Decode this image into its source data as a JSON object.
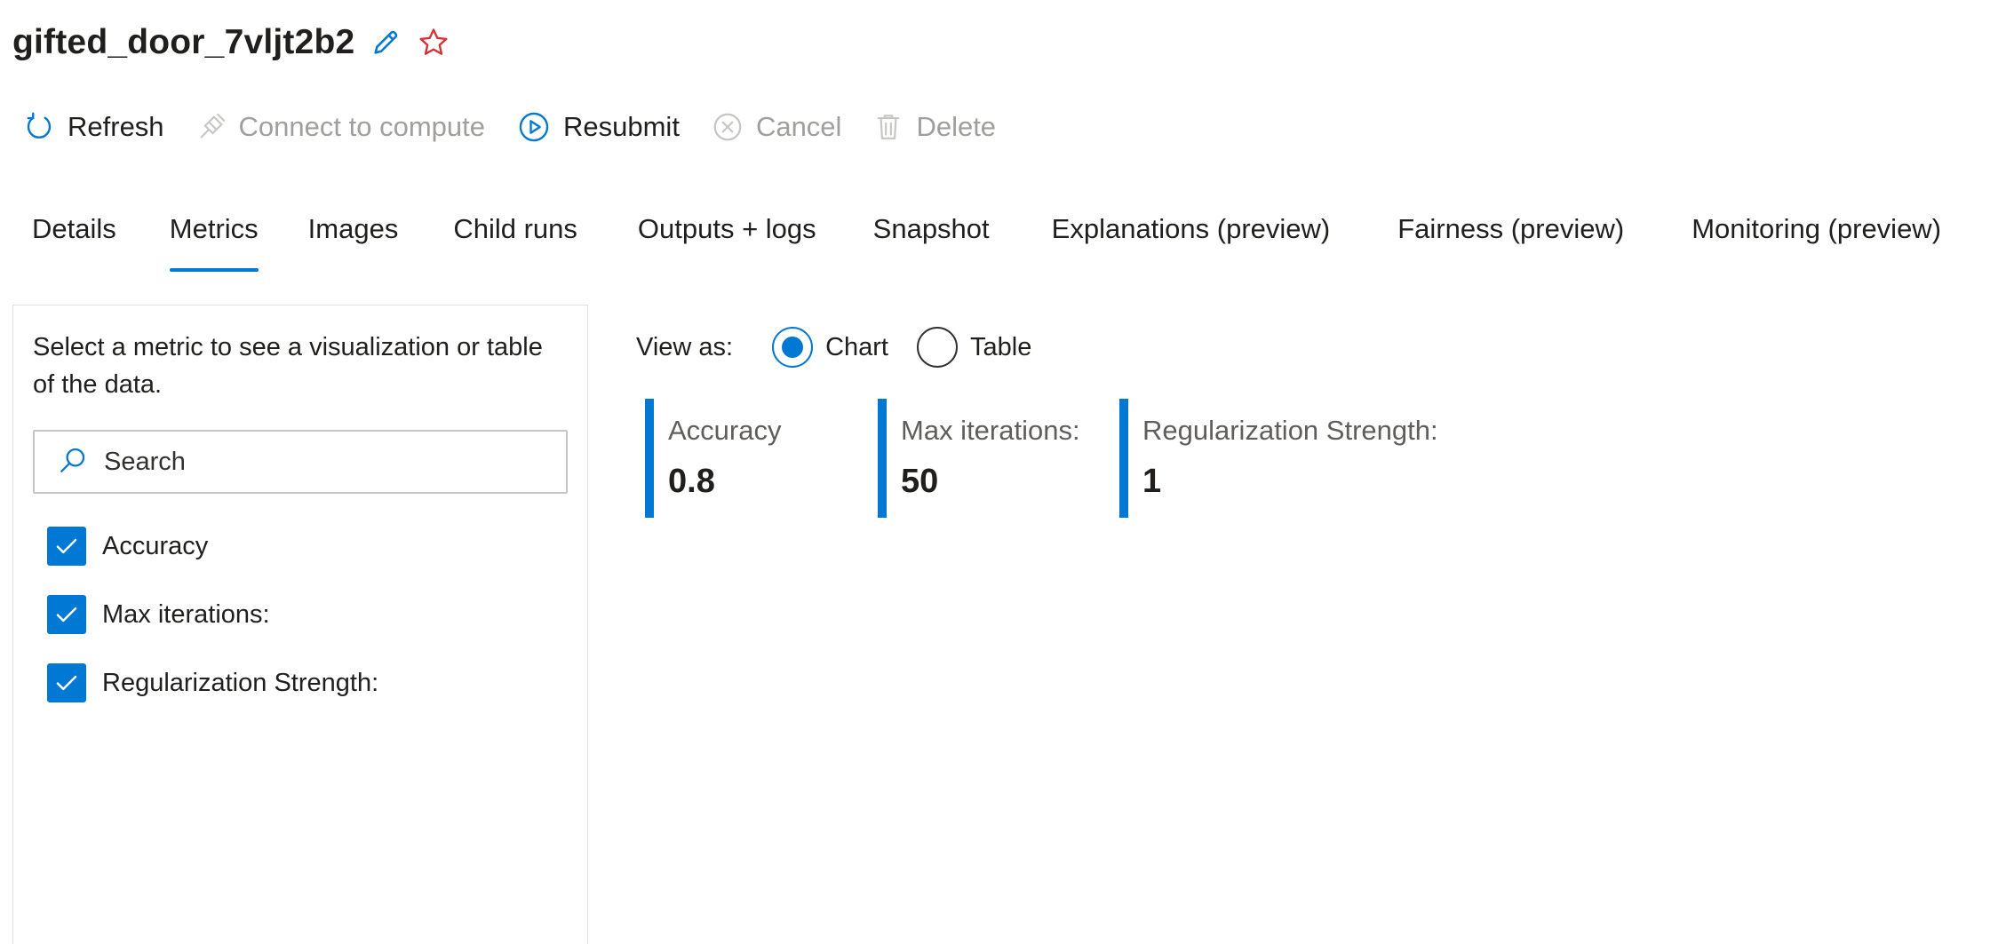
{
  "title": {
    "text": "gifted_door_7vljt2b2",
    "edit_icon": "pencil-icon",
    "favorite_icon": "star-outline-icon",
    "favorite_color": "#d13438"
  },
  "toolbar": {
    "refresh": {
      "label": "Refresh",
      "icon": "refresh-icon"
    },
    "connect": {
      "label": "Connect to compute",
      "icon": "plug-icon"
    },
    "resubmit": {
      "label": "Resubmit",
      "icon": "play-circle-icon"
    },
    "cancel": {
      "label": "Cancel",
      "icon": "cancel-circle-icon"
    },
    "delete": {
      "label": "Delete",
      "icon": "trash-icon"
    }
  },
  "tabs": [
    {
      "label": "Details"
    },
    {
      "label": "Metrics"
    },
    {
      "label": "Images"
    },
    {
      "label": "Child runs"
    },
    {
      "label": "Outputs + logs"
    },
    {
      "label": "Snapshot"
    },
    {
      "label": "Explanations (preview)"
    },
    {
      "label": "Fairness (preview)"
    },
    {
      "label": "Monitoring (preview)"
    }
  ],
  "active_tab": "Metrics",
  "sidebar": {
    "description": "Select a metric to see a visualization or table of the data.",
    "search_placeholder": "Search",
    "metrics": [
      {
        "label": "Accuracy",
        "checked": true
      },
      {
        "label": "Max iterations:",
        "checked": true
      },
      {
        "label": "Regularization Strength:",
        "checked": true
      }
    ]
  },
  "view": {
    "label": "View as:",
    "options": [
      {
        "label": "Chart",
        "selected": true
      },
      {
        "label": "Table",
        "selected": false
      }
    ]
  },
  "cards": [
    {
      "label": "Accuracy",
      "value": "0.8"
    },
    {
      "label": "Max iterations:",
      "value": "50"
    },
    {
      "label": "Regularization Strength:",
      "value": "1"
    }
  ],
  "colors": {
    "accent": "#0078d4",
    "disabled_text": "#a19f9d"
  }
}
